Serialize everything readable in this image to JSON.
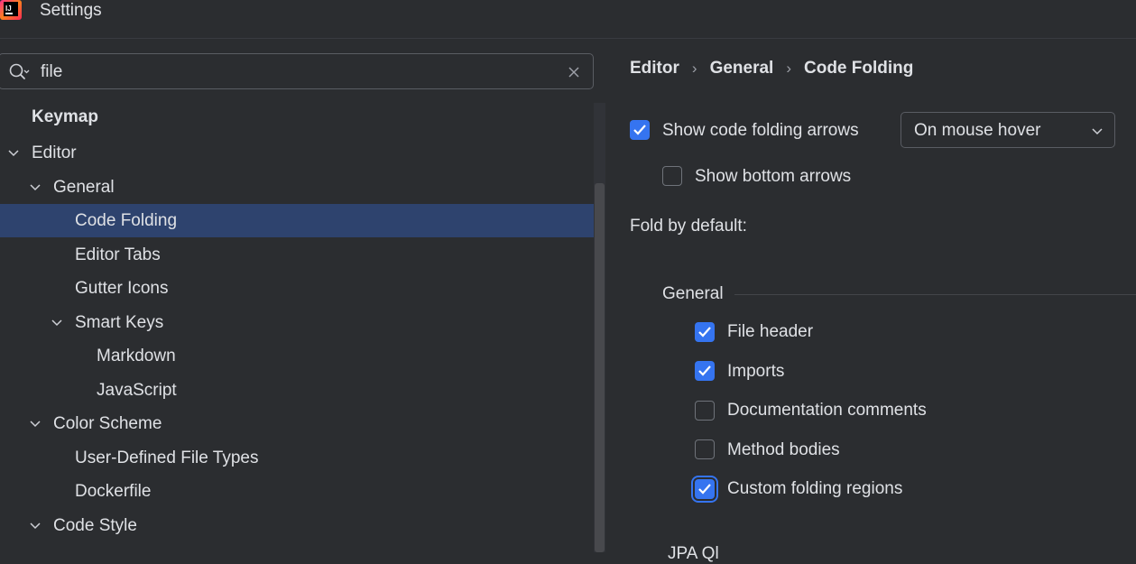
{
  "window": {
    "title": "Settings"
  },
  "search": {
    "value": "file",
    "placeholder": ""
  },
  "tree": [
    {
      "label": "Keymap",
      "level": 0,
      "chevron": false,
      "bold": true,
      "selected": false
    },
    {
      "label": "Editor",
      "level": 0,
      "chevron": true,
      "bold": false,
      "selected": false
    },
    {
      "label": "General",
      "level": 1,
      "chevron": true,
      "bold": false,
      "selected": false
    },
    {
      "label": "Code Folding",
      "level": 2,
      "chevron": false,
      "bold": false,
      "selected": true
    },
    {
      "label": "Editor Tabs",
      "level": 2,
      "chevron": false,
      "bold": false,
      "selected": false
    },
    {
      "label": "Gutter Icons",
      "level": 2,
      "chevron": false,
      "bold": false,
      "selected": false
    },
    {
      "label": "Smart Keys",
      "level": 2,
      "chevron": true,
      "bold": false,
      "selected": false
    },
    {
      "label": "Markdown",
      "level": 3,
      "chevron": false,
      "bold": false,
      "selected": false
    },
    {
      "label": "JavaScript",
      "level": 3,
      "chevron": false,
      "bold": false,
      "selected": false
    },
    {
      "label": "Color Scheme",
      "level": 1,
      "chevron": true,
      "bold": false,
      "selected": false
    },
    {
      "label": "User-Defined File Types",
      "level": 2,
      "chevron": false,
      "bold": false,
      "selected": false
    },
    {
      "label": "Dockerfile",
      "level": 2,
      "chevron": false,
      "bold": false,
      "selected": false
    },
    {
      "label": "Code Style",
      "level": 1,
      "chevron": true,
      "bold": false,
      "selected": false
    }
  ],
  "breadcrumb": {
    "items": [
      "Editor",
      "General",
      "Code Folding"
    ],
    "separator": "›"
  },
  "options": {
    "show_arrows": {
      "label": "Show code folding arrows",
      "checked": true
    },
    "arrows_mode": {
      "value": "On mouse hover"
    },
    "show_bottom_arrows": {
      "label": "Show bottom arrows",
      "checked": false
    },
    "fold_by_default_label": "Fold by default:",
    "general_section": {
      "title": "General",
      "items": [
        {
          "label": "File header",
          "checked": true
        },
        {
          "label": "Imports",
          "checked": true
        },
        {
          "label": "Documentation comments",
          "checked": false
        },
        {
          "label": "Method bodies",
          "checked": false
        },
        {
          "label": "Custom folding regions",
          "checked": true
        }
      ]
    },
    "next_section_partial": "JPA Ql"
  },
  "colors": {
    "accent": "#3574f0",
    "selection": "#2e436e",
    "background": "#2b2d30",
    "text": "#dfe1e5"
  },
  "icons": [
    "app-logo-icon",
    "search-icon",
    "clear-icon",
    "chevron-down-icon",
    "checkmark-icon"
  ]
}
